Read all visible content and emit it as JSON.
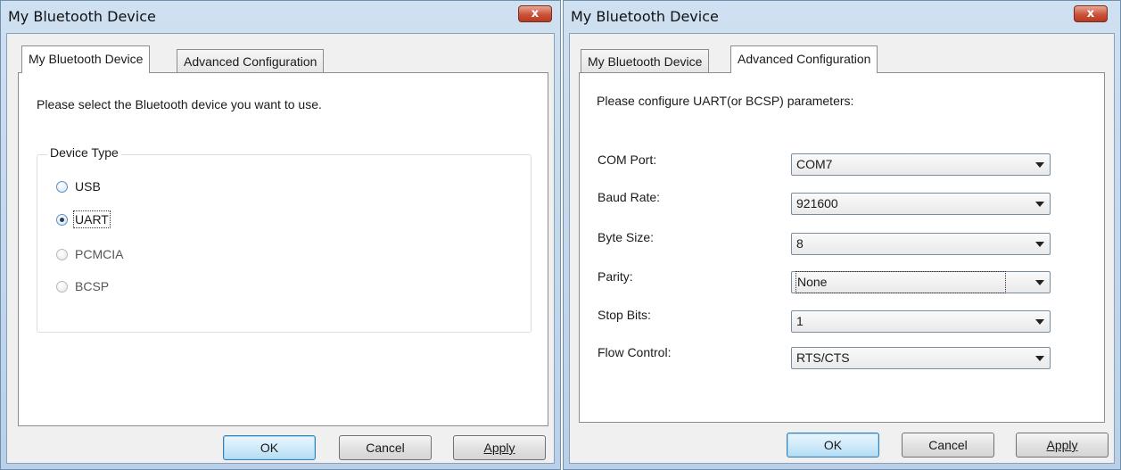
{
  "left_dialog": {
    "title": "My Bluetooth Device",
    "close_label": "x",
    "tabs": [
      {
        "label": "My Bluetooth Device",
        "active": true
      },
      {
        "label": "Advanced Configuration",
        "active": false
      }
    ],
    "intro": "Please select the Bluetooth device you want to use.",
    "group_label": "Device Type",
    "radios": [
      {
        "label": "USB",
        "checked": false
      },
      {
        "label": "UART",
        "checked": true
      },
      {
        "label": "PCMCIA",
        "checked": false
      },
      {
        "label": "BCSP",
        "checked": false
      }
    ],
    "buttons": {
      "ok": "OK",
      "cancel": "Cancel",
      "apply": "Apply"
    }
  },
  "right_dialog": {
    "title": "My Bluetooth Device",
    "close_label": "x",
    "tabs": [
      {
        "label": "My Bluetooth Device",
        "active": false
      },
      {
        "label": "Advanced Configuration",
        "active": true
      }
    ],
    "intro": "Please configure UART(or BCSP) parameters:",
    "fields": [
      {
        "label": "COM Port:",
        "value": "COM7"
      },
      {
        "label": "Baud Rate:",
        "value": "921600"
      },
      {
        "label": "Byte Size:",
        "value": "8"
      },
      {
        "label": "Parity:",
        "value": "None"
      },
      {
        "label": "Stop Bits:",
        "value": "1"
      },
      {
        "label": "Flow Control:",
        "value": "RTS/CTS"
      }
    ],
    "buttons": {
      "ok": "OK",
      "cancel": "Cancel",
      "apply": "Apply"
    }
  }
}
